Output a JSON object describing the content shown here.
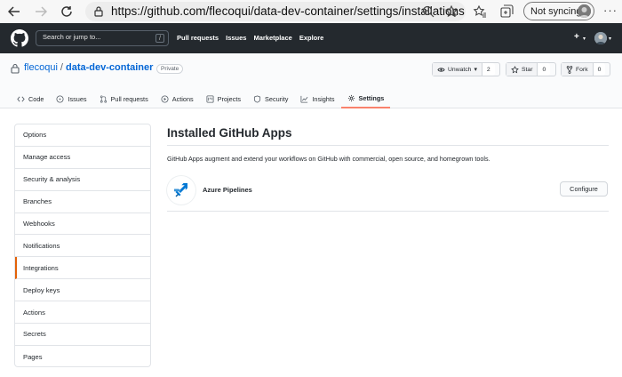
{
  "browser": {
    "url": "https://github.com/flecoqui/data-dev-container/settings/installations",
    "sync_label": "Not syncing",
    "more_label": "···"
  },
  "gh_header": {
    "search_placeholder": "Search or jump to...",
    "search_shortcut": "/",
    "nav": [
      "Pull requests",
      "Issues",
      "Marketplace",
      "Explore"
    ],
    "plus_label": "+"
  },
  "repo": {
    "owner": "flecoqui",
    "separator": "/",
    "name": "data-dev-container",
    "visibility": "Private",
    "unwatch_label": "Unwatch",
    "watch_count": "2",
    "star_label": "Star",
    "star_count": "0",
    "fork_label": "Fork",
    "fork_count": "0",
    "tabs": [
      {
        "label": "Code",
        "icon": "code-icon"
      },
      {
        "label": "Issues",
        "icon": "issue-icon"
      },
      {
        "label": "Pull requests",
        "icon": "pull-request-icon"
      },
      {
        "label": "Actions",
        "icon": "play-icon"
      },
      {
        "label": "Projects",
        "icon": "project-icon"
      },
      {
        "label": "Security",
        "icon": "shield-icon"
      },
      {
        "label": "Insights",
        "icon": "graph-icon"
      },
      {
        "label": "Settings",
        "icon": "gear-icon",
        "active": true
      }
    ]
  },
  "sidebar": {
    "items": [
      {
        "label": "Options"
      },
      {
        "label": "Manage access"
      },
      {
        "label": "Security & analysis"
      },
      {
        "label": "Branches"
      },
      {
        "label": "Webhooks"
      },
      {
        "label": "Notifications"
      },
      {
        "label": "Integrations",
        "active": true
      },
      {
        "label": "Deploy keys"
      },
      {
        "label": "Actions"
      },
      {
        "label": "Secrets"
      },
      {
        "label": "Pages"
      }
    ]
  },
  "main": {
    "title": "Installed GitHub Apps",
    "description": "GitHub Apps augment and extend your workflows on GitHub with commercial, open source, and homegrown tools.",
    "apps": [
      {
        "name": "Azure Pipelines",
        "action_label": "Configure",
        "icon": "azure-pipelines-icon"
      }
    ]
  },
  "colors": {
    "header_bg": "#24292e",
    "link": "#0366d6",
    "active_tab_underline": "#f9826c",
    "active_sidebar_border": "#e36209",
    "azure_blue": "#0078d4"
  }
}
